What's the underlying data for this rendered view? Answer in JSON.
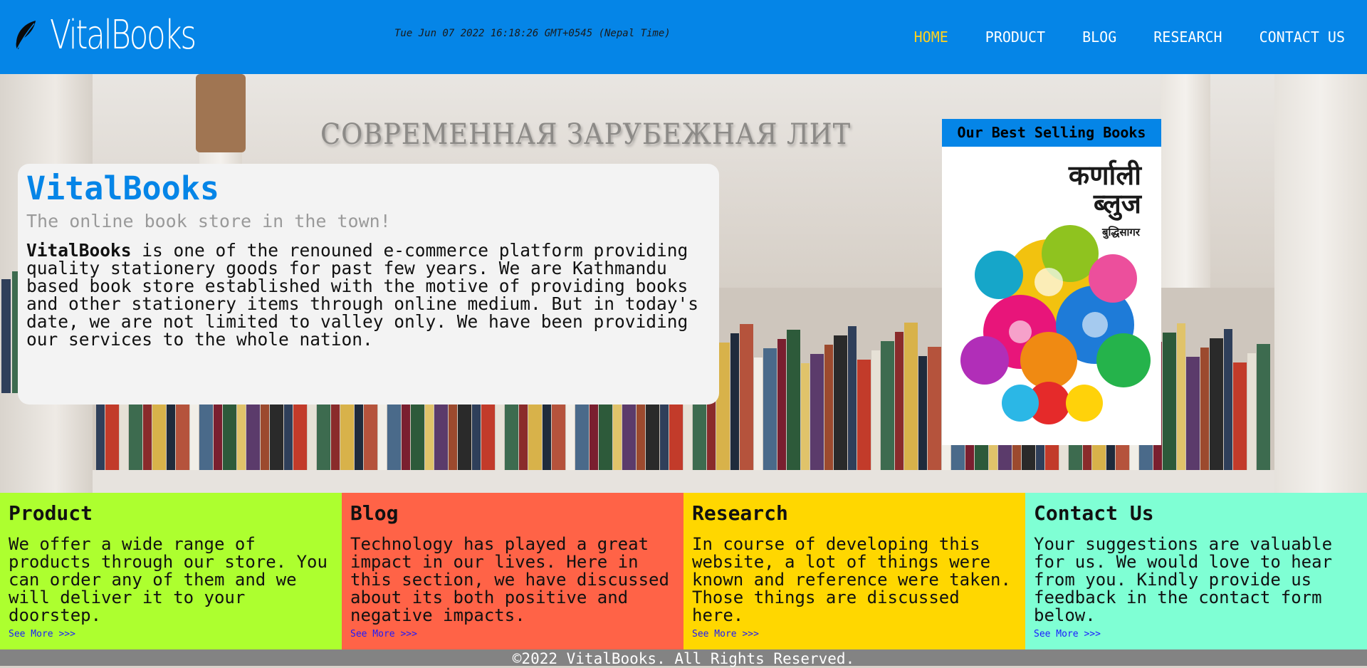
{
  "header": {
    "logo_text": "VitalBooks",
    "datetime": "Tue Jun 07 2022 16:18:26 GMT+0545 (Nepal Time)",
    "nav": [
      {
        "label": "HOME",
        "active": true
      },
      {
        "label": "PRODUCT",
        "active": false
      },
      {
        "label": "BLOG",
        "active": false
      },
      {
        "label": "RESEARCH",
        "active": false
      },
      {
        "label": "CONTACT US",
        "active": false
      }
    ]
  },
  "hero": {
    "background_sign": "СОВРЕМЕННАЯ ЗАРУБЕЖНАЯ ЛИТ",
    "title": "VitalBooks",
    "subtitle": "The online book store in the town!",
    "body_brand": "VitalBooks",
    "body": " is one of the renouned e-commerce platform providing quality stationery goods for past few years. We are Kathmandu based book store established with the motive of providing books and other stationery items through online medium. But in today's date, we are not limited to valley only. We have been providing our services to the whole nation."
  },
  "bestseller": {
    "title": "Our Best Selling Books",
    "cover_title_line1": "कर्णाली",
    "cover_title_line2": "ब्लुज",
    "cover_author": "बुद्धिसागर"
  },
  "features": [
    {
      "title": "Product",
      "text": "We offer a wide range of products through our store. You can order any of them and we will deliver it to your doorstep.",
      "link": "See More >>>",
      "color": "#adff2f"
    },
    {
      "title": "Blog",
      "text": "Technology has played a great impact in our lives. Here in this section, we have discussed about its both positive and negative impacts.",
      "link": "See More >>>",
      "color": "#ff6347"
    },
    {
      "title": "Research",
      "text": "In course of developing this website, a lot of things were known and reference were taken. Those things are discussed here.",
      "link": "See More >>>",
      "color": "#ffd700"
    },
    {
      "title": "Contact Us",
      "text": "Your suggestions are valuable for us. We would love to hear from you. Kindly provide us feedback in the contact form below.",
      "link": "See More >>>",
      "color": "#7fffd4"
    }
  ],
  "footer": {
    "text": "©2022 VitalBooks. All Rights Reserved."
  },
  "colors": {
    "brand": "#0585e7",
    "nav_active": "#ffd21f",
    "footer_bg": "#838383",
    "link": "#1a1aff"
  }
}
